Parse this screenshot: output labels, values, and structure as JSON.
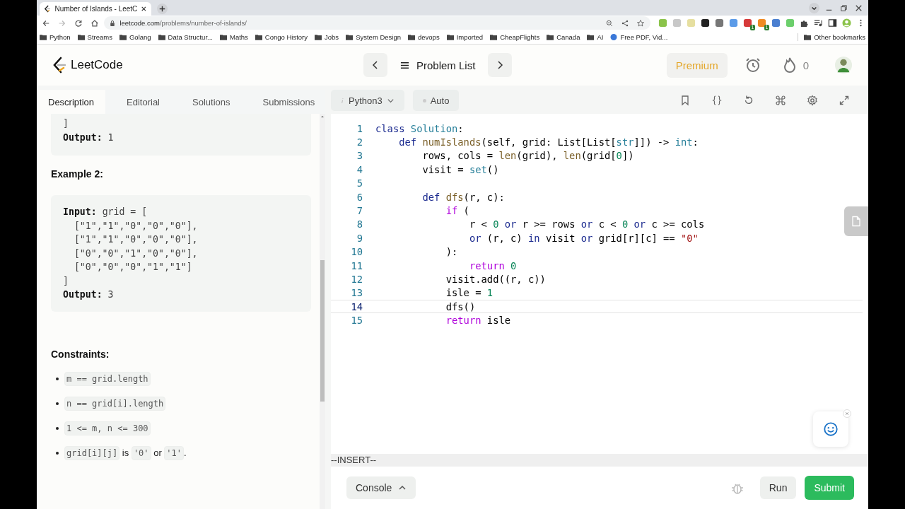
{
  "browser": {
    "tab_title": "Number of Islands - LeetC",
    "url_host": "leetcode.com",
    "url_path": "/problems/number-of-islands/",
    "extension_badges": [
      "1",
      "1"
    ],
    "bookmarks": [
      "Python",
      "Streams",
      "Golang",
      "Data Structur...",
      "Maths",
      "Congo History",
      "Jobs",
      "System Design",
      "devops",
      "Imported",
      "CheapFlights",
      "Canada",
      "AI"
    ],
    "web_bookmark": "Free PDF, Vid...",
    "other_bookmarks": "Other bookmarks"
  },
  "header": {
    "logo": "LeetCode",
    "problem_list": "Problem List",
    "premium": "Premium",
    "streak": "0"
  },
  "left_tabs": [
    {
      "label": "Description",
      "selected": true
    },
    {
      "label": "Editorial",
      "selected": false
    },
    {
      "label": "Solutions",
      "selected": false
    },
    {
      "label": "Submissions",
      "selected": false
    }
  ],
  "description": {
    "example_1": [
      {
        "text": "]"
      },
      {
        "label": "Output:",
        "text": "1"
      }
    ],
    "example_2_title": "Example 2:",
    "example_2": [
      {
        "label": "Input:",
        "text": "grid = ["
      },
      {
        "text": "  [\"1\",\"1\",\"0\",\"0\",\"0\"],"
      },
      {
        "text": "  [\"1\",\"1\",\"0\",\"0\",\"0\"],"
      },
      {
        "text": "  [\"0\",\"0\",\"1\",\"0\",\"0\"],"
      },
      {
        "text": "  [\"0\",\"0\",\"0\",\"1\",\"1\"]"
      },
      {
        "text": "]"
      },
      {
        "label": "Output:",
        "text": "3"
      }
    ],
    "constraints_title": "Constraints:",
    "constraints": [
      [
        {
          "text": "m == grid.length",
          "code": true
        }
      ],
      [
        {
          "text": "n == grid[i].length",
          "code": true
        }
      ],
      [
        {
          "text": "1 <= m, n <= 300",
          "code": true
        }
      ],
      [
        {
          "text": "grid[i][j]",
          "code": true
        },
        {
          "text": " is ",
          "code": false
        },
        {
          "text": "'0'",
          "code": true
        },
        {
          "text": " or ",
          "code": false
        },
        {
          "text": "'1'",
          "code": true
        },
        {
          "text": ".",
          "code": false
        }
      ]
    ]
  },
  "editor": {
    "language": "Python3",
    "mode": "Auto",
    "status": "--INSERT--",
    "lines": [
      {
        "number": "1",
        "current": false,
        "tokens": [
          {
            "text": "class",
            "kind": "kw"
          },
          {
            "text": " Solution",
            "kind": "type"
          },
          ":"
        ]
      },
      {
        "number": "2",
        "current": false,
        "tokens": [
          {
            "text": "    def",
            "kind": "kw"
          },
          {
            "text": " numIslands",
            "kind": "fn"
          },
          "(self, grid: List[List[",
          {
            "text": "str",
            "kind": "type"
          },
          "]]) -> ",
          {
            "text": "int",
            "kind": "type"
          },
          ":"
        ]
      },
      {
        "number": "3",
        "current": false,
        "tokens": [
          "        rows, cols = ",
          {
            "text": "len",
            "kind": "fn"
          },
          "(grid), ",
          {
            "text": "len",
            "kind": "fn"
          },
          "(grid[",
          {
            "text": "0",
            "kind": "num"
          },
          "])"
        ]
      },
      {
        "number": "4",
        "current": false,
        "tokens": [
          "        visit = ",
          {
            "text": "set",
            "kind": "type"
          },
          "()"
        ]
      },
      {
        "number": "5",
        "current": false
      },
      {
        "number": "6",
        "current": false,
        "tokens": [
          {
            "text": "        def",
            "kind": "kw"
          },
          {
            "text": " dfs",
            "kind": "fn"
          },
          "(r, c):"
        ]
      },
      {
        "number": "7",
        "current": false,
        "tokens": [
          {
            "text": "            if",
            "kind": "ctrl"
          },
          " ("
        ]
      },
      {
        "number": "8",
        "current": false,
        "tokens": [
          "                r < ",
          {
            "text": "0",
            "kind": "num"
          },
          {
            "text": " or",
            "kind": "kw"
          },
          " r >= rows ",
          {
            "text": "or",
            "kind": "kw"
          },
          " c < ",
          {
            "text": "0",
            "kind": "num"
          },
          {
            "text": " or",
            "kind": "kw"
          },
          " c >= cols"
        ]
      },
      {
        "number": "9",
        "current": false,
        "tokens": [
          {
            "text": "                or",
            "kind": "kw"
          },
          " (r, c) ",
          {
            "text": "in",
            "kind": "kw"
          },
          " visit ",
          {
            "text": "or",
            "kind": "kw"
          },
          " grid[r][c] == ",
          {
            "text": "\"0\"",
            "kind": "str"
          }
        ]
      },
      {
        "number": "10",
        "current": false,
        "tokens": [
          "            ):"
        ]
      },
      {
        "number": "11",
        "current": false,
        "tokens": [
          {
            "text": "                return",
            "kind": "ctrl"
          },
          {
            "text": " 0",
            "kind": "num"
          }
        ]
      },
      {
        "number": "12",
        "current": false,
        "tokens": [
          "            visit.add((r, c))"
        ]
      },
      {
        "number": "13",
        "current": false,
        "tokens": [
          "            isle = ",
          {
            "text": "1",
            "kind": "num"
          }
        ]
      },
      {
        "number": "14",
        "current": true,
        "tokens": [
          "            dfs()"
        ]
      },
      {
        "number": "15",
        "current": false,
        "tokens": [
          {
            "text": "            return",
            "kind": "ctrl"
          },
          " isle"
        ]
      }
    ]
  },
  "footer": {
    "console": "Console",
    "run": "Run",
    "submit": "Submit"
  }
}
